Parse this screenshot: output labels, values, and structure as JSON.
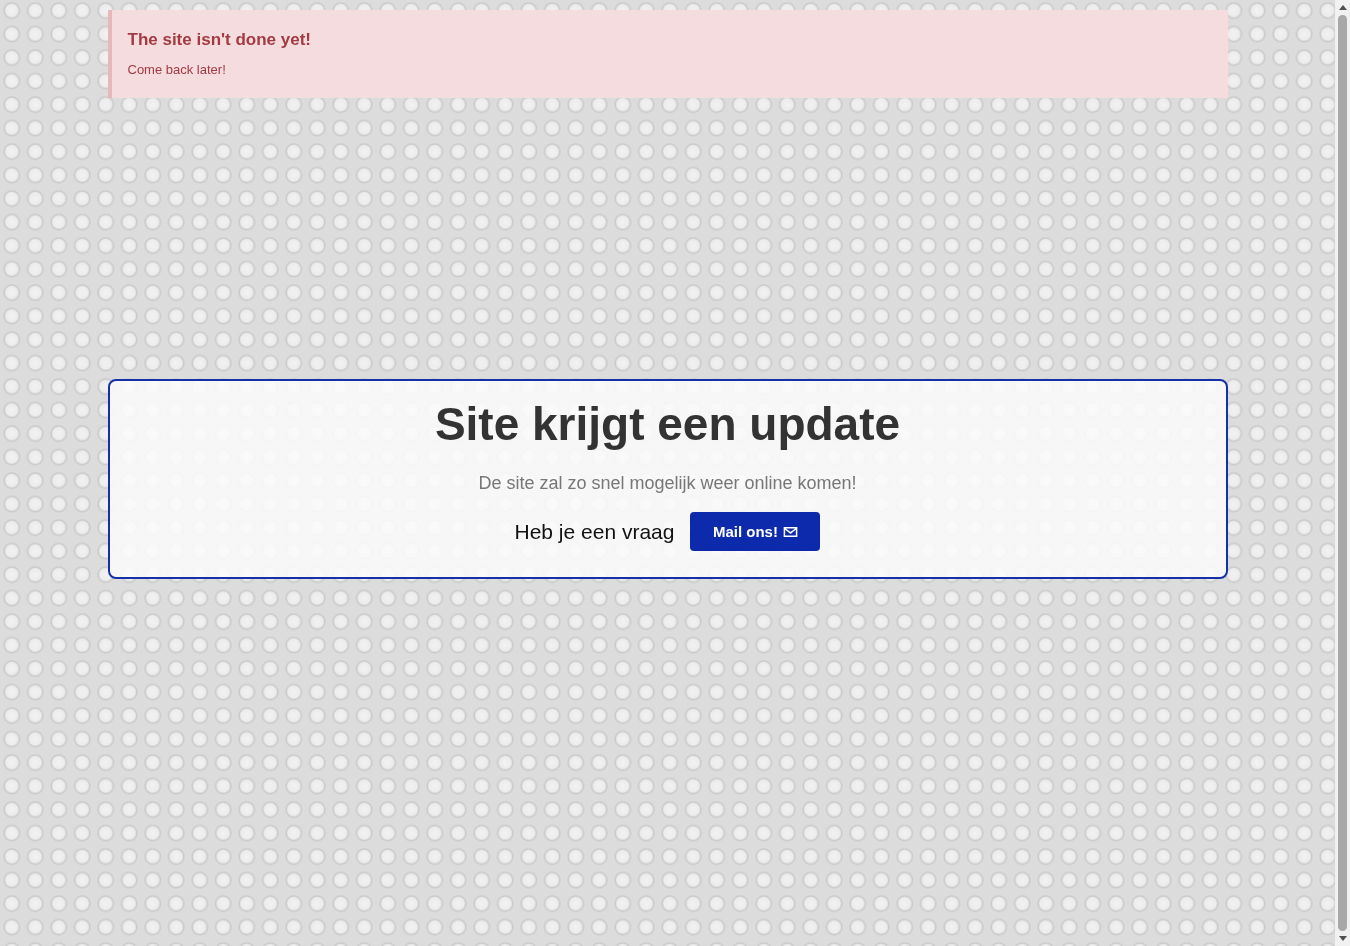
{
  "alert": {
    "title": "The site isn't done yet!",
    "message": "Come back later!"
  },
  "card": {
    "heading": "Site krijgt een update",
    "subtitle": "De site zal zo snel mogelijk weer online komen!",
    "question": "Heb je een vraag",
    "button": "Mail ons!"
  }
}
